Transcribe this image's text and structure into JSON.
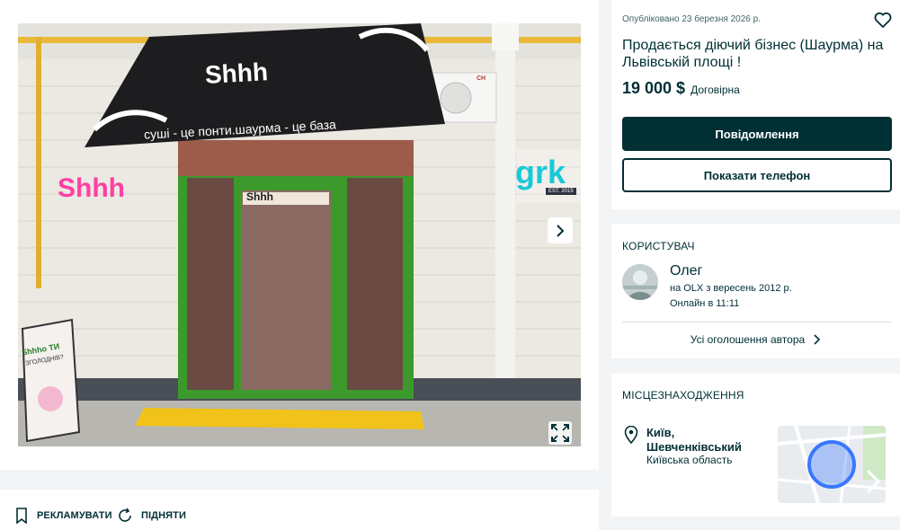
{
  "listing": {
    "posted": "Опубліковано 23 березня 2026 р.",
    "title": "Продається діючий бізнес (Шаурма) на Львівській площі !",
    "price": "19 000 $",
    "price_note": "Договірна",
    "message_button": "Повідомлення",
    "phone_button": "Показати телефон"
  },
  "gallery": {
    "storefront_sign": "Shhh",
    "awning_slogan": "суші - це понти.шаурма - це база",
    "neighbor_sign": "grk",
    "neighbor_sign_est": "EST. 2015",
    "ac_brand": "CH",
    "stand_text_1": "Shhho ТИ",
    "stand_text_2": "ЗГОЛОДНІВ?"
  },
  "user": {
    "section_label": "Користувач",
    "name": "Олег",
    "since": "на OLX з вересень 2012 р.",
    "online": "Онлайн в 11:11",
    "all_ads": "Усі оголошення автора"
  },
  "location": {
    "section_label": "Місцезнаходження",
    "city": "Київ, Шевченківський",
    "region": "Київська область"
  },
  "actions": {
    "promote": "Рекламувати",
    "raise": "Підняти"
  },
  "colors": {
    "primary": "#002f34",
    "background": "#f2f4f5",
    "map_marker": "#3a77ff",
    "storefront_green": "#3c9a2c",
    "sign_pink": "#ff3fa4"
  },
  "icons": {
    "favorite": "heart-icon",
    "next": "chevron-right-icon",
    "fullscreen": "expand-icon",
    "promote": "bookmark-icon",
    "raise": "refresh-icon",
    "location": "map-pin-icon",
    "all_ads": "chevron-right-icon"
  }
}
